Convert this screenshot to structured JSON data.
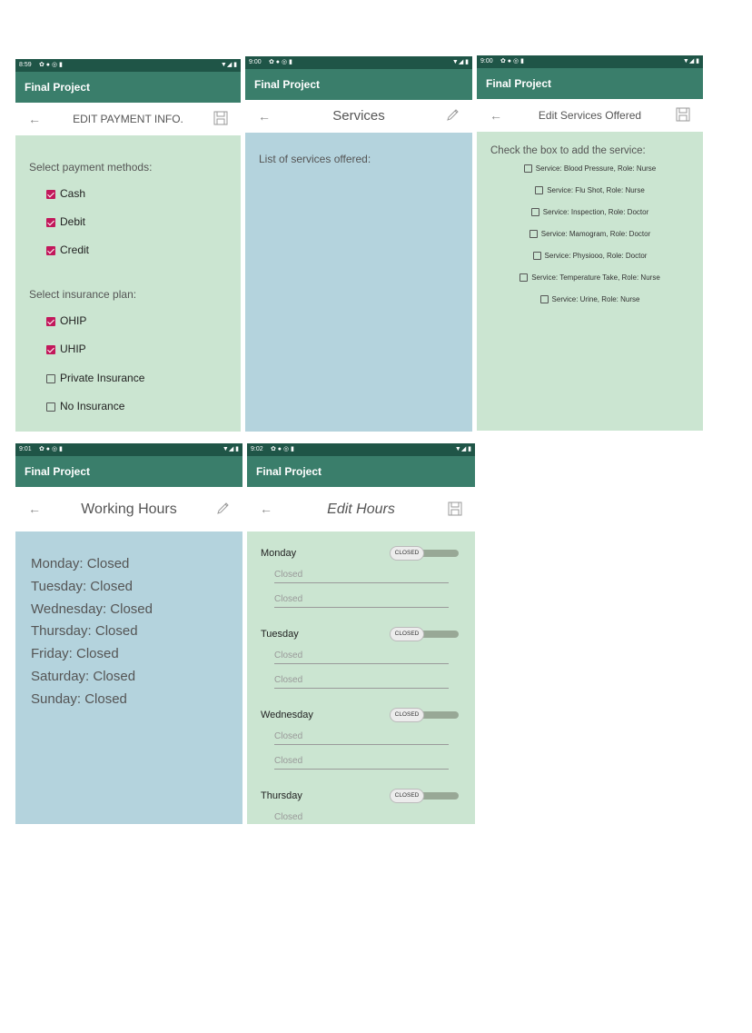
{
  "app_title": "Final Project",
  "icons": {
    "back": "arrow-left-icon",
    "save": "floppy-disk-icon",
    "edit": "pencil-icon"
  },
  "colors": {
    "appbar": "#3a7e6b",
    "statusbar": "#1f5547",
    "green_bg": "#cbe5d1",
    "blue_bg": "#b4d3dd",
    "checkbox_checked": "#c2185b"
  },
  "screens": {
    "payment": {
      "time": "8:59",
      "title": "EDIT PAYMENT INFO.",
      "methods_label": "Select payment methods:",
      "methods": [
        {
          "label": "Cash",
          "checked": true
        },
        {
          "label": "Debit",
          "checked": true
        },
        {
          "label": "Credit",
          "checked": true
        }
      ],
      "insurance_label": "Select insurance plan:",
      "insurance": [
        {
          "label": "OHIP",
          "checked": true
        },
        {
          "label": "UHIP",
          "checked": true
        },
        {
          "label": "Private Insurance",
          "checked": false
        },
        {
          "label": "No Insurance",
          "checked": false
        }
      ]
    },
    "services": {
      "time": "9:00",
      "title": "Services",
      "list_label": "List of services offered:"
    },
    "edit_services": {
      "time": "9:00",
      "title": "Edit Services Offered",
      "instruction": "Check the box to add the service:",
      "items": [
        {
          "label": "Service: Blood Pressure, Role: Nurse",
          "checked": false
        },
        {
          "label": "Service: Flu Shot, Role: Nurse",
          "checked": false
        },
        {
          "label": "Service: Inspection, Role: Doctor",
          "checked": false
        },
        {
          "label": "Service: Mamogram, Role: Doctor",
          "checked": false
        },
        {
          "label": "Service: Physiooo, Role: Doctor",
          "checked": false
        },
        {
          "label": "Service: Temperature Take, Role: Nurse",
          "checked": false
        },
        {
          "label": "Service: Urine, Role: Nurse",
          "checked": false
        }
      ]
    },
    "working_hours": {
      "time": "9:01",
      "title": "Working Hours",
      "days": [
        "Monday: Closed",
        "Tuesday: Closed",
        "Wednesday: Closed",
        "Thursday: Closed",
        "Friday: Closed",
        "Saturday: Closed",
        "Sunday: Closed"
      ]
    },
    "edit_hours": {
      "time": "9:02",
      "title": "Edit Hours",
      "toggle_label": "CLOSED",
      "days": [
        {
          "day": "Monday",
          "open": "Closed",
          "close": "Closed"
        },
        {
          "day": "Tuesday",
          "open": "Closed",
          "close": "Closed"
        },
        {
          "day": "Wednesday",
          "open": "Closed",
          "close": "Closed"
        },
        {
          "day": "Thursday",
          "open": "Closed"
        }
      ]
    }
  }
}
